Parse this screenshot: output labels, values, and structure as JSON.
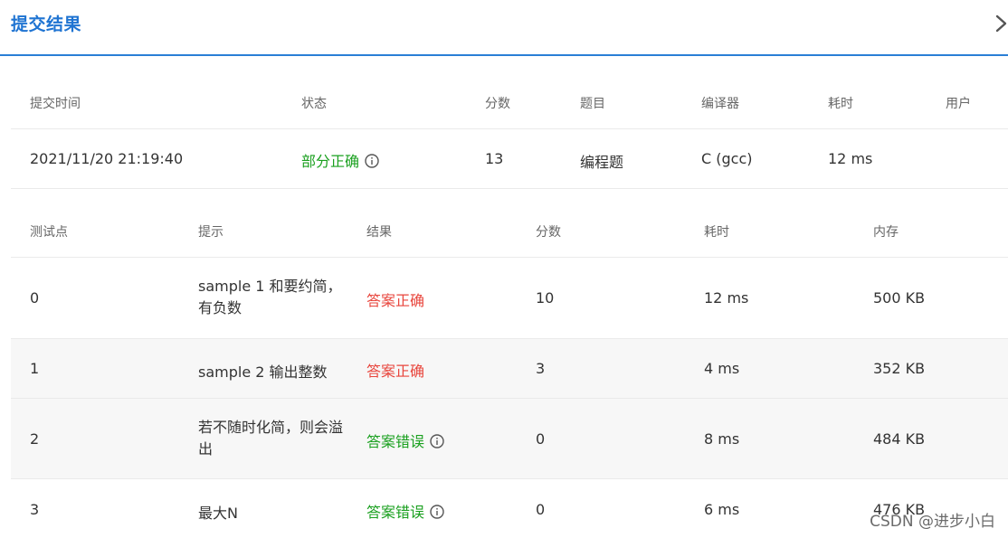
{
  "header": {
    "title": "提交结果",
    "close_icon": "close-chevron-icon"
  },
  "summary": {
    "columns": [
      "提交时间",
      "状态",
      "分数",
      "题目",
      "编译器",
      "耗时",
      "用户"
    ],
    "row": {
      "time": "2021/11/20 21:19:40",
      "status": "部分正确",
      "score": "13",
      "problem": "编程题",
      "compiler": "C (gcc)",
      "elapsed": "12 ms"
    }
  },
  "testcases": {
    "columns": [
      "测试点",
      "提示",
      "结果",
      "分数",
      "耗时",
      "内存"
    ],
    "rows": [
      {
        "id": "0",
        "hint": "sample 1 和要约简，有负数",
        "result": "答案正确",
        "score": "10",
        "time": "12 ms",
        "memory": "500 KB"
      },
      {
        "id": "1",
        "hint": "sample 2 输出整数",
        "result": "答案正确",
        "score": "3",
        "time": "4 ms",
        "memory": "352 KB"
      },
      {
        "id": "2",
        "hint": "若不随时化简，则会溢出",
        "result": "答案错误",
        "score": "0",
        "time": "8 ms",
        "memory": "484 KB"
      },
      {
        "id": "3",
        "hint": "最大N",
        "result": "答案错误",
        "score": "0",
        "time": "6 ms",
        "memory": "476 KB"
      }
    ]
  },
  "colors": {
    "accent": "#1f74d2",
    "green": "#1aa01f",
    "red": "#e8453c"
  },
  "watermark": "CSDN @进步小白"
}
